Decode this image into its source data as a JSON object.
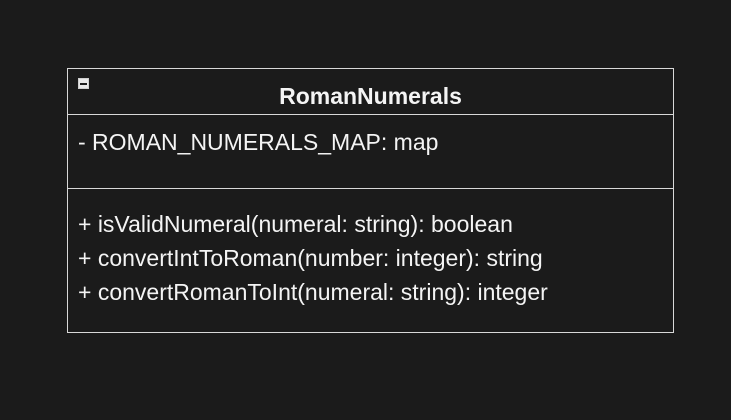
{
  "class": {
    "name": "RomanNumerals",
    "attributes": [
      "- ROMAN_NUMERALS_MAP: map"
    ],
    "operations": [
      "+ isValidNumeral(numeral: string): boolean",
      "+ convertIntToRoman(number: integer): string",
      "+ convertRomanToInt(numeral: string): integer"
    ]
  }
}
